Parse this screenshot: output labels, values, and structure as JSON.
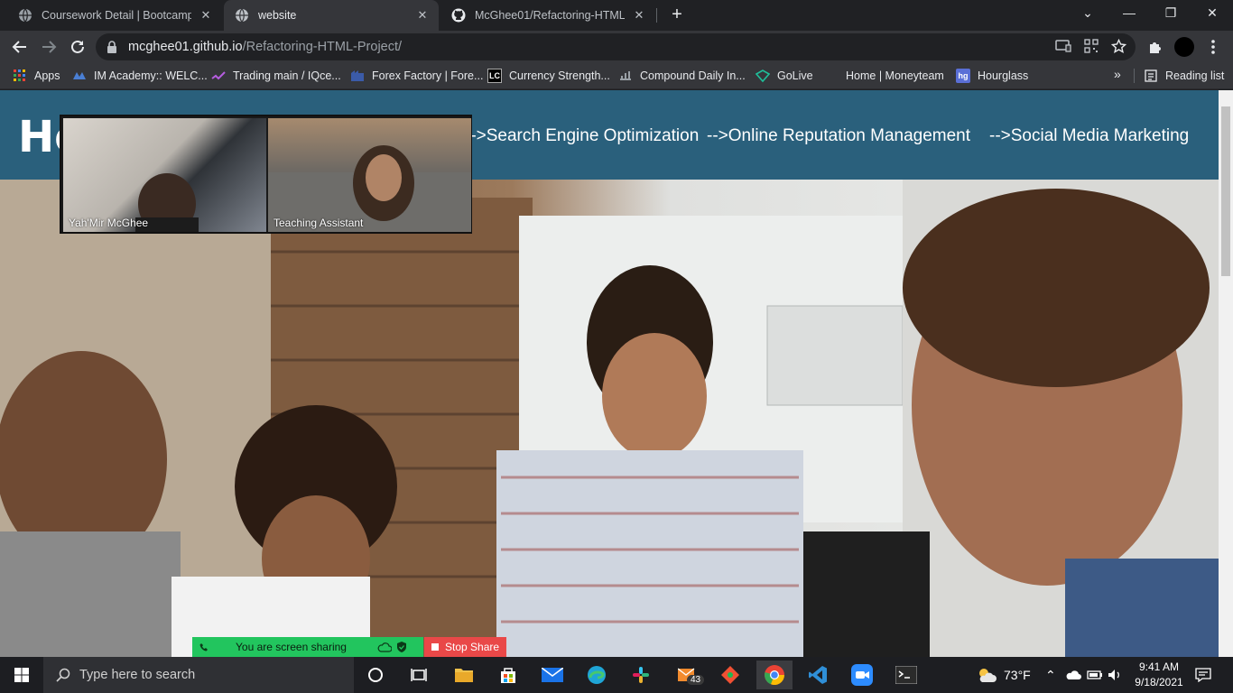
{
  "browser": {
    "tabs": [
      {
        "title": "Coursework Detail | Bootcamp Sp",
        "active": false
      },
      {
        "title": "website",
        "active": true
      },
      {
        "title": "McGhee01/Refactoring-HTML-Pr",
        "active": false
      }
    ],
    "url_host": "mcghee01.github.io",
    "url_path": "/Refactoring-HTML-Project/",
    "bookmarks": [
      {
        "label": "Apps",
        "icon": "apps-grid-icon"
      },
      {
        "label": "IM Academy:: WELC...",
        "icon": "im-academy-icon"
      },
      {
        "label": "Trading main / IQce...",
        "icon": "trading-icon"
      },
      {
        "label": "Forex Factory | Fore...",
        "icon": "forex-factory-icon"
      },
      {
        "label": "Currency Strength...",
        "icon": "lc-icon"
      },
      {
        "label": "Compound Daily In...",
        "icon": "compound-icon"
      },
      {
        "label": "GoLive",
        "icon": "golive-icon"
      },
      {
        "label": "Home | Moneyteam",
        "icon": "blank-icon"
      },
      {
        "label": "Hourglass",
        "icon": "hourglass-icon"
      }
    ],
    "bookmarks_more": "»",
    "reading_list": "Reading list"
  },
  "site": {
    "logo_partial": "Ho",
    "nav": [
      "-->Search Engine Optimization",
      "-->Online Reputation Management",
      "-->Social Media Marketing"
    ],
    "header_color": "#2a607c"
  },
  "zoom": {
    "participants": [
      {
        "name": "Yah'Mir McGhee"
      },
      {
        "name": "Teaching Assistant"
      }
    ],
    "sharing_text": "You are screen sharing",
    "stop_share": "Stop Share"
  },
  "taskbar": {
    "search_placeholder": "Type here to search",
    "mail_badge": "43",
    "weather": "73°F",
    "time": "9:41 AM",
    "date": "9/18/2021"
  }
}
